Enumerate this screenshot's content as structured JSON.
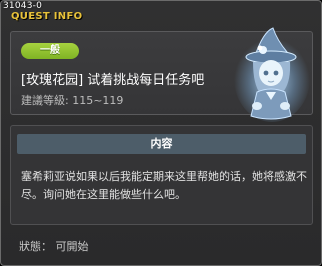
{
  "window": {
    "id_tag": "31043-0",
    "title": "QUEST INFO"
  },
  "summary": {
    "badge": "一般",
    "quest_name": "[玫瑰花园] 试着挑战每日任务吧",
    "level_label": "建议等级",
    "level_value": "115~119",
    "level_text": "建議等級: 115~119",
    "npc_icon": "witch-girl-npc-portrait"
  },
  "content": {
    "header": "内容",
    "description": "塞希莉亚说如果以后我能定期来这里帮她的话，她将感激不尽。询问她在这里能做些什么吧。"
  },
  "status": {
    "text": "狀態： 可開始"
  },
  "colors": {
    "title": "#e8c23a",
    "badge": "#93c531",
    "header_bar": "#4d5d69",
    "npc_glow": "#8fc9ff"
  }
}
